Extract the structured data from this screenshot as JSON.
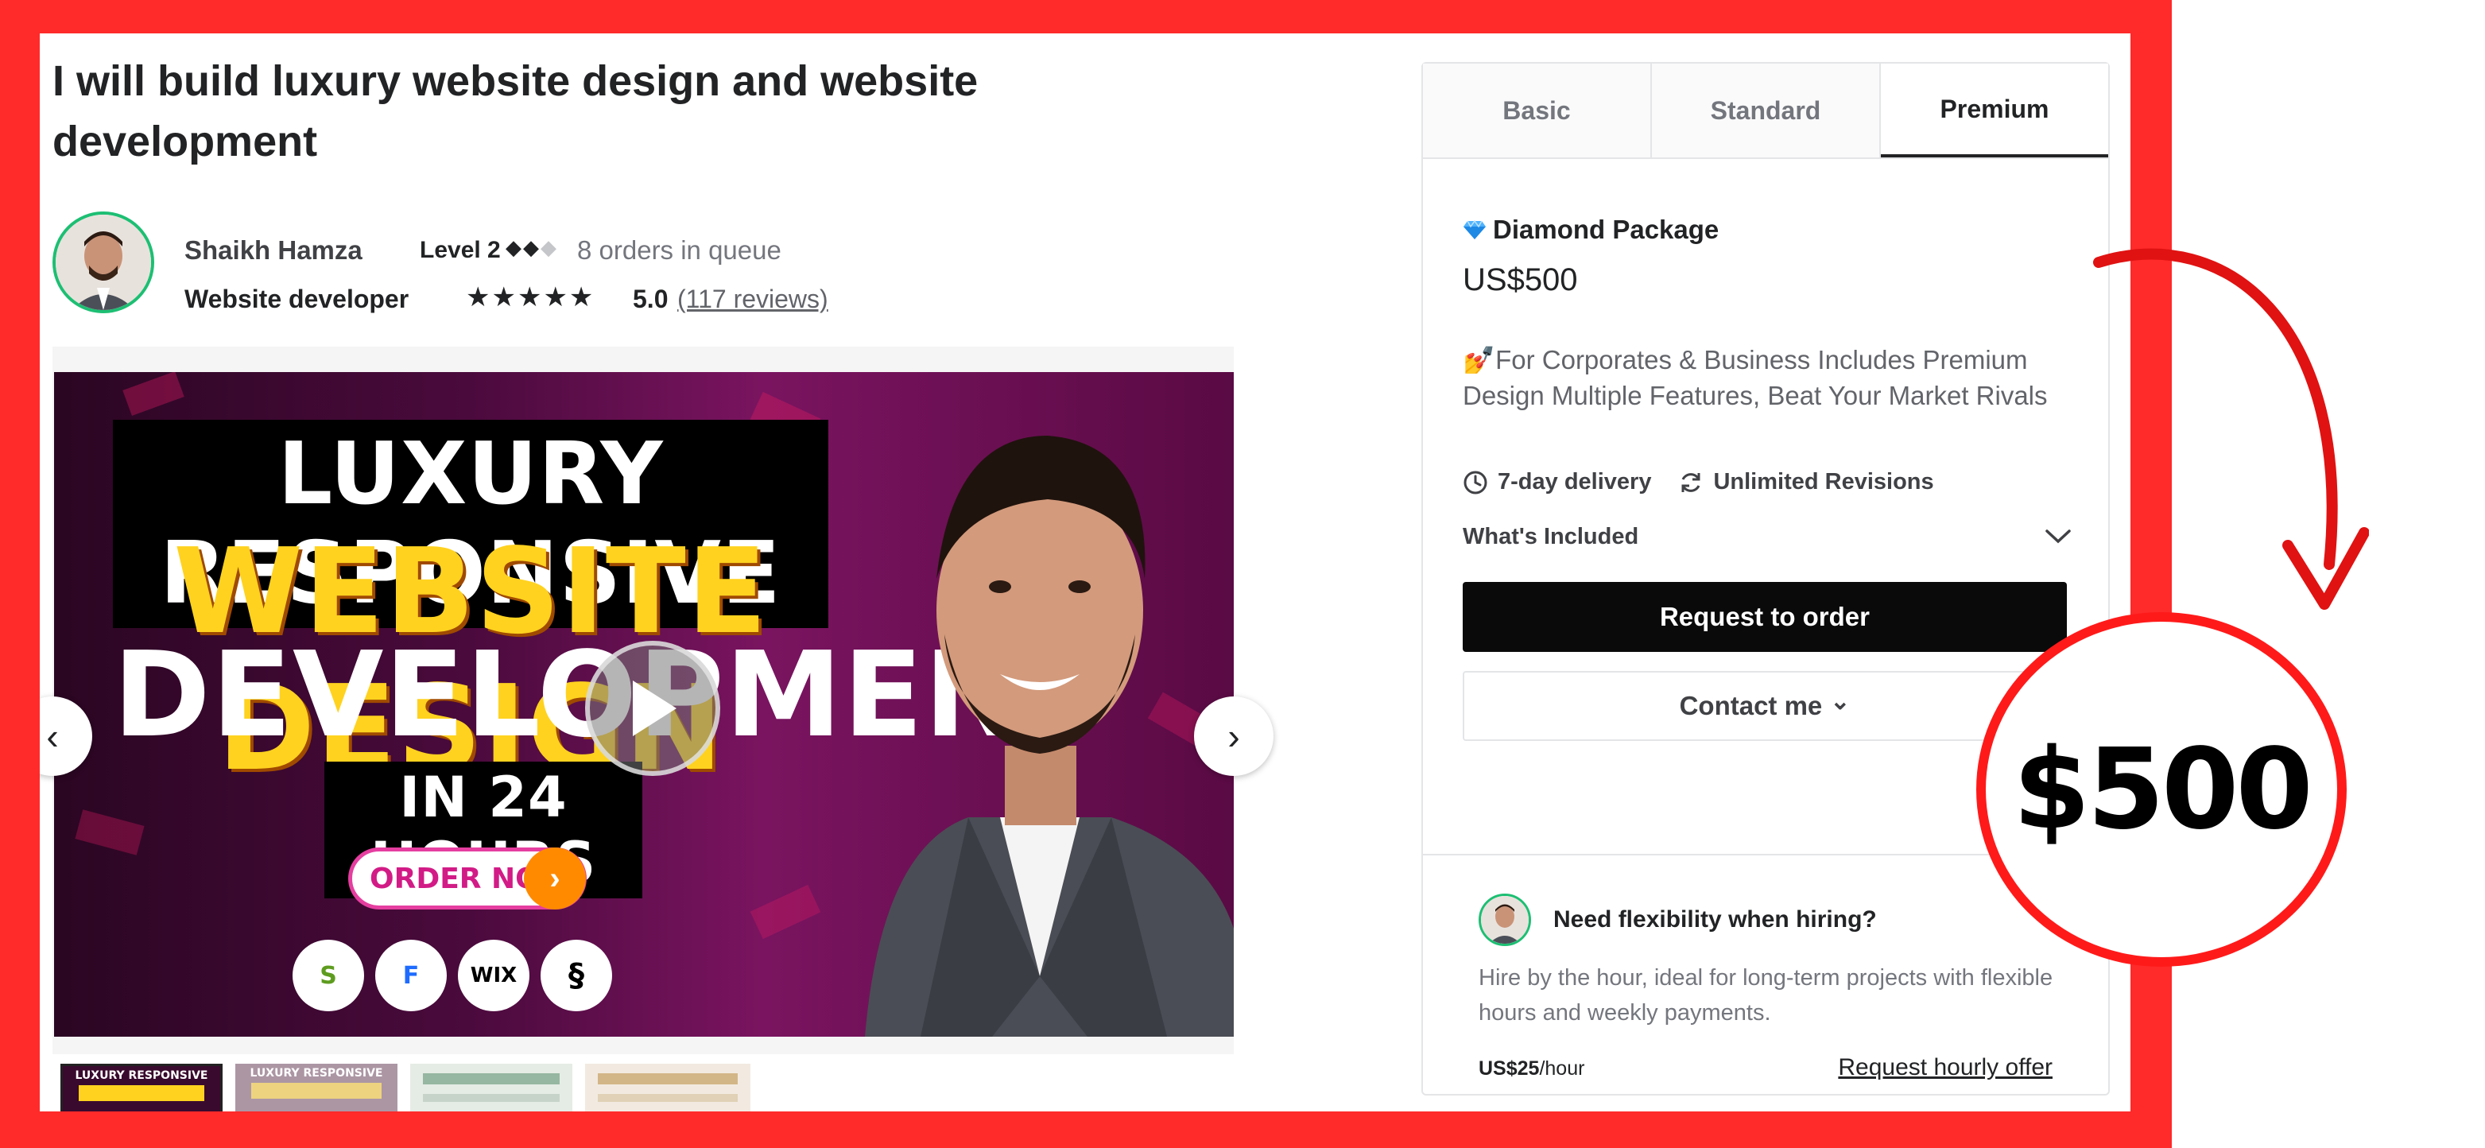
{
  "gig": {
    "title": "I will build luxury website design and website development"
  },
  "seller": {
    "name": "Shaikh Hamza",
    "level": "Level 2",
    "level_diamonds": "◆◆",
    "level_diamonds_dim": "◆",
    "orders_in_queue": "8 orders in queue",
    "role": "Website developer",
    "stars": "★★★★★",
    "rating": "5.0",
    "reviews": "(117 reviews)"
  },
  "gallery": {
    "thumbnail_text": {
      "line1": "LUXURY RESPONSIVE",
      "line2": "WEBSITE DESIGN",
      "line3": "DEVELOPMENT",
      "line4": "IN 24 HOURS",
      "cta": "ORDER NOW",
      "cta_arrow": "›"
    },
    "brand_logos": [
      "S",
      "F",
      "WIX",
      "§"
    ],
    "prev_icon": "‹",
    "next_icon": "›",
    "thumb_labels": [
      "LUXURY RESPONSIVE",
      "LUXURY RESPONSIVE"
    ]
  },
  "packages": {
    "tabs": [
      "Basic",
      "Standard",
      "Premium"
    ],
    "active_tab": "Premium",
    "name": "Diamond Package",
    "price": "US$500",
    "description": "💅For Corporates & Business Includes Premium Design Multiple Features, Beat Your Market Rivals",
    "delivery": "7-day delivery",
    "revisions": "Unlimited Revisions",
    "whats_included": "What's Included",
    "request_button": "Request to order",
    "contact_button": "Contact me",
    "contact_chevron": "⌄"
  },
  "flexibility": {
    "title": "Need flexibility when hiring?",
    "description": "Hire by the hour, ideal for long-term projects with flexible hours and weekly payments.",
    "rate_value": "US$25",
    "rate_unit": "/hour",
    "link": "Request hourly offer"
  },
  "annotation": {
    "price": "$500"
  },
  "colors": {
    "frame": "#ff2a2a",
    "accent_green": "#1dbf73",
    "button_dark": "#0a0a0a"
  }
}
